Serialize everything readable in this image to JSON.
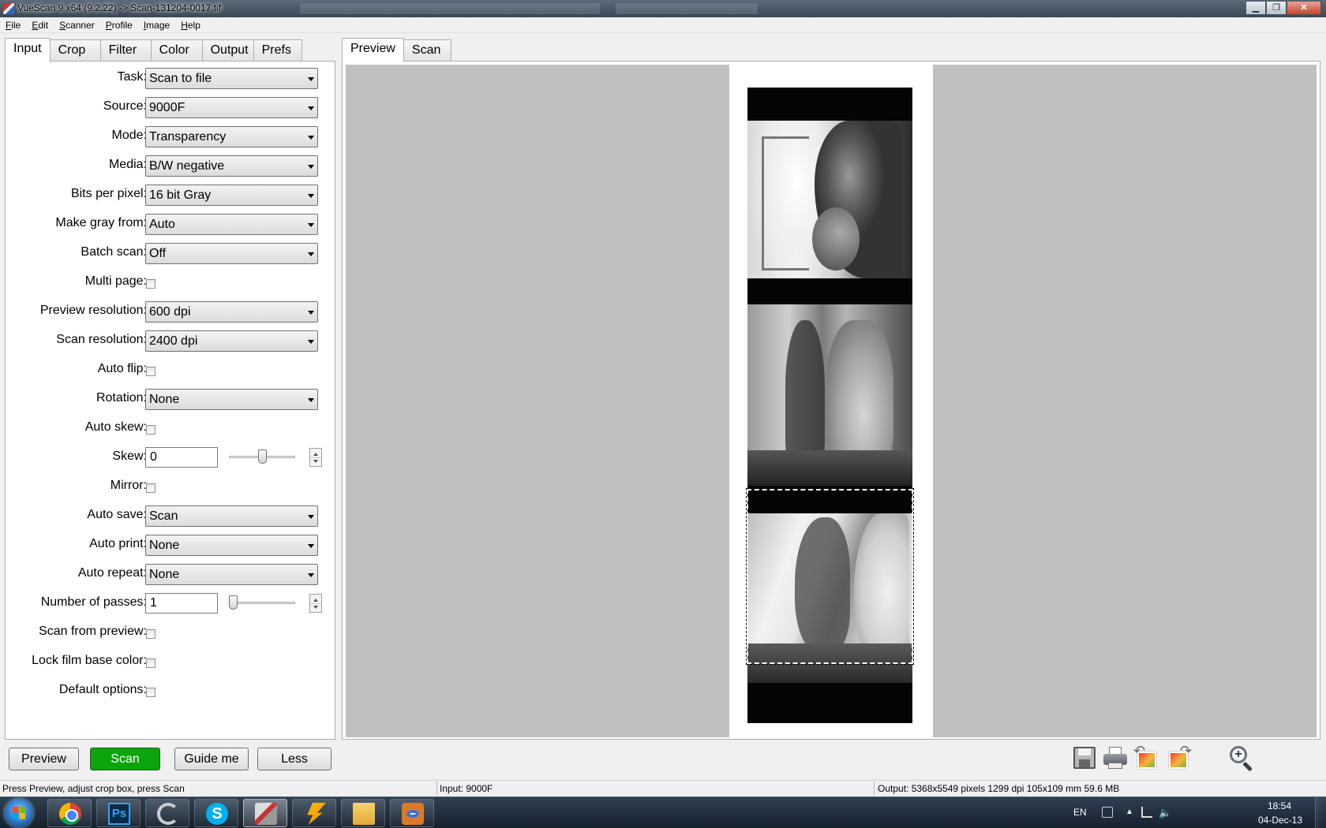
{
  "window": {
    "title": "VueScan 9 x64 (9.2.22) -> Scan-131204-0017.tif",
    "controls": {
      "minimize": "▁",
      "maximize": "❐",
      "close": "✕"
    }
  },
  "menu": [
    "File",
    "Edit",
    "Scanner",
    "Profile",
    "Image",
    "Help"
  ],
  "left_tabs": [
    "Input",
    "Crop",
    "Filter",
    "Color",
    "Output",
    "Prefs"
  ],
  "right_tabs": [
    "Preview",
    "Scan"
  ],
  "fields": {
    "task": {
      "label": "Task:",
      "value": "Scan to file"
    },
    "source": {
      "label": "Source:",
      "value": "9000F"
    },
    "mode": {
      "label": "Mode:",
      "value": "Transparency"
    },
    "media": {
      "label": "Media:",
      "value": "B/W negative"
    },
    "bits": {
      "label": "Bits per pixel:",
      "value": "16 bit Gray"
    },
    "gray": {
      "label": "Make gray from:",
      "value": "Auto"
    },
    "batch": {
      "label": "Batch scan:",
      "value": "Off"
    },
    "multipage": {
      "label": "Multi page:",
      "checked": false
    },
    "preview_res": {
      "label": "Preview resolution:",
      "value": "600 dpi"
    },
    "scan_res": {
      "label": "Scan resolution:",
      "value": "2400 dpi"
    },
    "autoflip": {
      "label": "Auto flip:",
      "checked": false
    },
    "rotation": {
      "label": "Rotation:",
      "value": "None"
    },
    "autoskew": {
      "label": "Auto skew:",
      "checked": false
    },
    "skew": {
      "label": "Skew:",
      "value": "0",
      "slider_fraction": 0.5
    },
    "mirror": {
      "label": "Mirror:",
      "checked": false
    },
    "autosave": {
      "label": "Auto save:",
      "value": "Scan"
    },
    "autoprint": {
      "label": "Auto print:",
      "value": "None"
    },
    "autorepeat": {
      "label": "Auto repeat:",
      "value": "None"
    },
    "passes": {
      "label": "Number of passes:",
      "value": "1",
      "slider_fraction": 0.0
    },
    "scanfromprev": {
      "label": "Scan from preview:",
      "checked": false
    },
    "lockfilm": {
      "label": "Lock film base color:",
      "checked": false
    },
    "defaults": {
      "label": "Default options:",
      "checked": false
    }
  },
  "buttons": {
    "preview": "Preview",
    "scan": "Scan",
    "guide": "Guide me",
    "less": "Less"
  },
  "toolbar_icons": [
    "save-icon",
    "print-icon",
    "rotate-left-icon",
    "rotate-right-icon",
    "zoom-in-icon"
  ],
  "status": {
    "hint": "Press Preview, adjust crop box, press Scan",
    "input": "Input: 9000F",
    "output": "Output: 5368x5549 pixels 1299 dpi 105x109 mm 59.6 MB"
  },
  "taskbar": {
    "apps": [
      "chrome-icon",
      "photoshop-icon",
      "eclipse-icon",
      "skype-icon",
      "vuescan-icon",
      "winamp-icon",
      "explorer-icon",
      "eye-app-icon"
    ],
    "ps_glyph": "Ps",
    "skype_glyph": "S",
    "lang": "EN",
    "time": "18:54",
    "date": "04-Dec-13"
  },
  "colors": {
    "scan_button": "#0ca50c",
    "preview_bg": "#c0c0c0",
    "title_bar": "#3b4754"
  }
}
